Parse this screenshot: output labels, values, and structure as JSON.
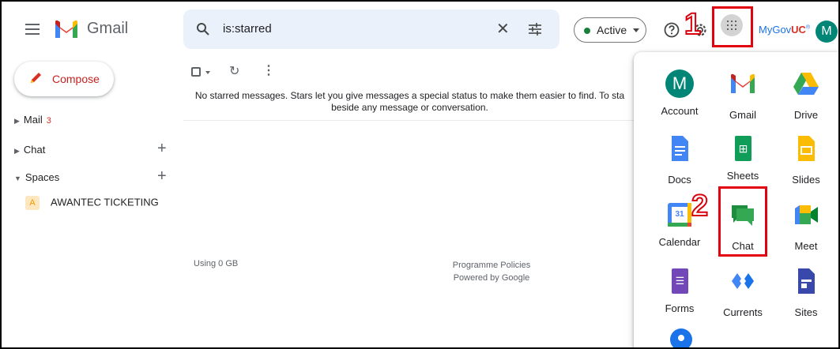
{
  "header": {
    "brand": "Gmail",
    "search_value": "is:starred",
    "status_label": "Active",
    "org_name": "MyGov",
    "org_suffix": "UC",
    "avatar_letter": "M",
    "step_1": "1"
  },
  "nav": {
    "compose_label": "Compose",
    "mail_label": "Mail",
    "mail_count": "3",
    "chat_label": "Chat",
    "spaces_label": "Spaces",
    "space_icon_letter": "A",
    "space_name": "AWANTEC TICKETING"
  },
  "main": {
    "empty_line1": "No starred messages. Stars let you give messages a special status to make them easier to find. To sta",
    "empty_line2": "beside any message or conversation.",
    "storage": "Using 0 GB",
    "policies": "Programme Policies",
    "powered": "Powered by Google"
  },
  "apps_panel": {
    "step_2": "2",
    "account_letter": "M",
    "sheets_glyph": "⊞",
    "forms_glyph": "☰",
    "calendar_day": "31",
    "apps": [
      {
        "name": "Account",
        "icon": "account-avatar-icon"
      },
      {
        "name": "Gmail",
        "icon": "gmail-icon"
      },
      {
        "name": "Drive",
        "icon": "drive-icon"
      },
      {
        "name": "Docs",
        "icon": "docs-icon"
      },
      {
        "name": "Sheets",
        "icon": "sheets-icon"
      },
      {
        "name": "Slides",
        "icon": "slides-icon"
      },
      {
        "name": "Calendar",
        "icon": "calendar-icon"
      },
      {
        "name": "Chat",
        "icon": "chat-icon"
      },
      {
        "name": "Meet",
        "icon": "meet-icon"
      },
      {
        "name": "Forms",
        "icon": "forms-icon"
      },
      {
        "name": "Currents",
        "icon": "currents-icon"
      },
      {
        "name": "Sites",
        "icon": "sites-icon"
      }
    ]
  },
  "colors": {
    "annotation_red": "#e3000f",
    "active_green": "#188038",
    "avatar_teal": "#008577",
    "compose_red": "#c5221f"
  }
}
